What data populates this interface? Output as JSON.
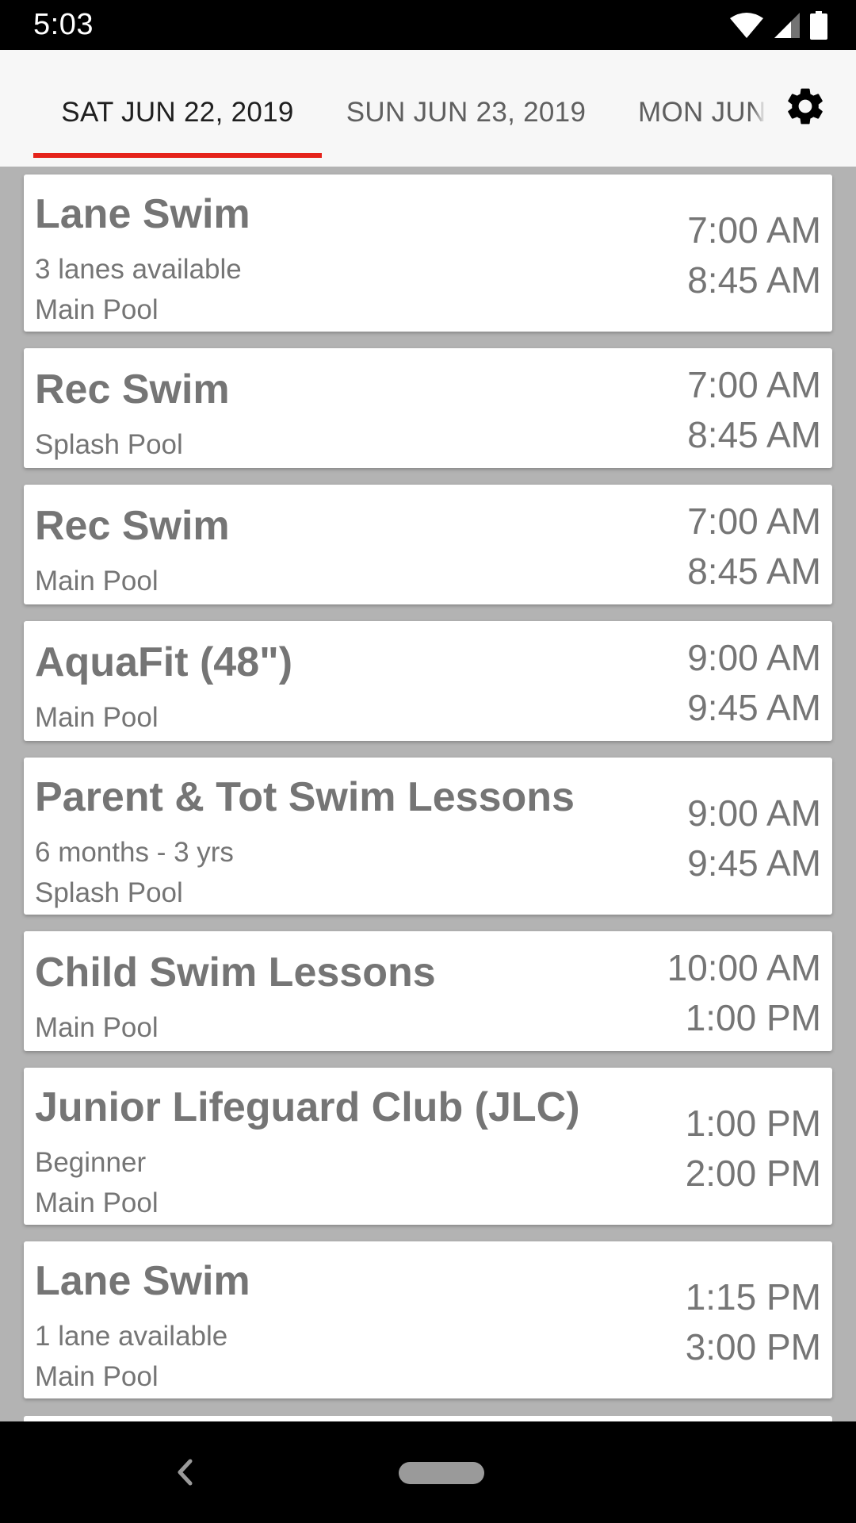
{
  "status_bar": {
    "time": "5:03",
    "icons": [
      "wifi-icon",
      "cell-signal-icon",
      "battery-icon"
    ]
  },
  "tabs": [
    {
      "label": "SAT JUN 22, 2019",
      "selected": true
    },
    {
      "label": "SUN JUN 23, 2019",
      "selected": false
    },
    {
      "label": "MON JUN",
      "selected": false
    }
  ],
  "colors": {
    "accent": "#e5231b",
    "text_primary": "#757575",
    "background": "#b3b3b3"
  },
  "sessions": [
    {
      "title": "Lane Swim",
      "lines": [
        "3 lanes available",
        "Main Pool"
      ],
      "start": "7:00 AM",
      "end": "8:45 AM"
    },
    {
      "title": "Rec Swim",
      "lines": [
        "Splash Pool"
      ],
      "start": "7:00 AM",
      "end": "8:45 AM"
    },
    {
      "title": "Rec Swim",
      "lines": [
        "Main Pool"
      ],
      "start": "7:00 AM",
      "end": "8:45 AM"
    },
    {
      "title": "AquaFit (48\")",
      "lines": [
        "Main Pool"
      ],
      "start": "9:00 AM",
      "end": "9:45 AM"
    },
    {
      "title": "Parent & Tot Swim Lessons",
      "lines": [
        "6 months - 3 yrs",
        "Splash Pool"
      ],
      "start": "9:00 AM",
      "end": "9:45 AM"
    },
    {
      "title": "Child Swim Lessons",
      "lines": [
        "Main Pool"
      ],
      "start": "10:00 AM",
      "end": "1:00 PM"
    },
    {
      "title": "Junior Lifeguard Club (JLC)",
      "lines": [
        "Beginner",
        "Main Pool"
      ],
      "start": "1:00 PM",
      "end": "2:00 PM"
    },
    {
      "title": "Lane Swim",
      "lines": [
        "1 lane available",
        "Main Pool"
      ],
      "start": "1:15 PM",
      "end": "3:00 PM"
    }
  ]
}
